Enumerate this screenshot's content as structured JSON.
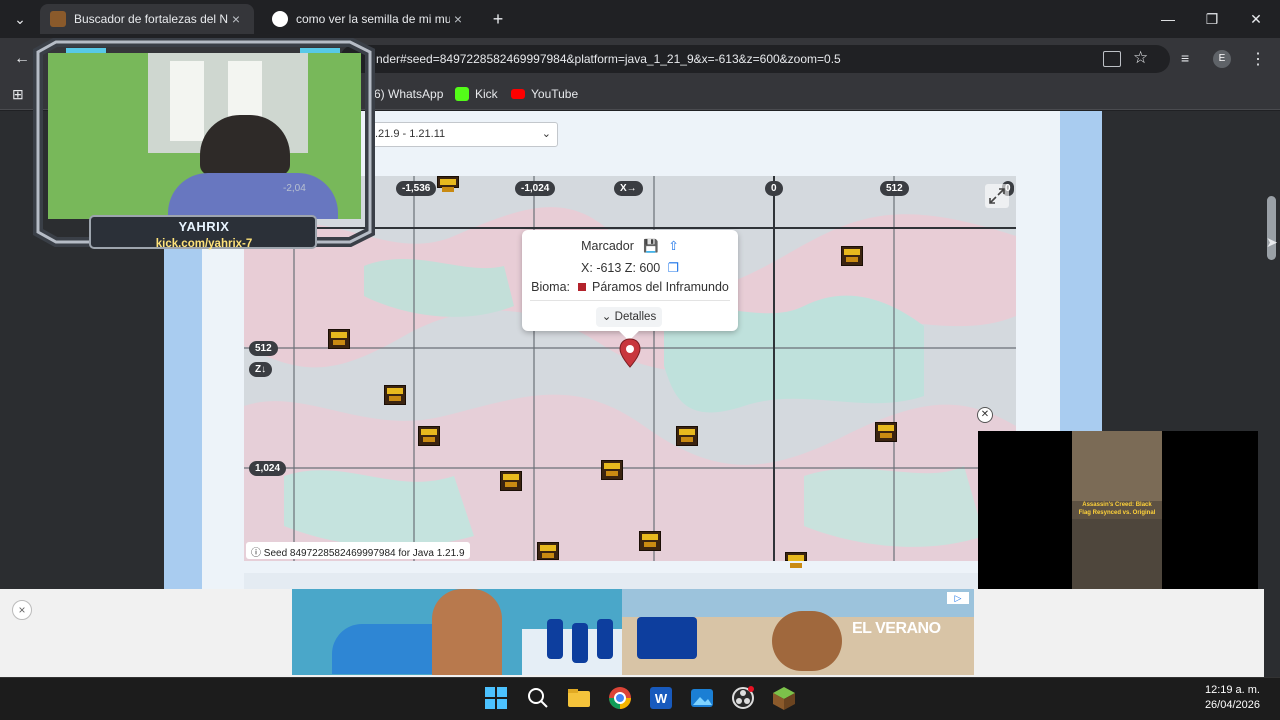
{
  "browser": {
    "tabs": [
      {
        "title": "Buscador de fortalezas del Neth",
        "active": true
      },
      {
        "title": "como ver la semilla de mi mund",
        "active": false
      }
    ],
    "new_tab_icon": "plus-icon",
    "window_controls": [
      "minimize",
      "restore",
      "close"
    ],
    "url": "nder#seed=8497228582469997984&platform=java_1_21_9&x=-613&z=600&zoom=0.5",
    "profile_initial": "E",
    "bookmarks": [
      {
        "label": "6) WhatsApp"
      },
      {
        "label": "Kick"
      },
      {
        "label": "YouTube"
      }
    ]
  },
  "page": {
    "version_select": ".21.9 - 1.21.11",
    "x_axis_labels": [
      "-1,536",
      "-1,024",
      "X→",
      "0",
      "512"
    ],
    "x_axis_label_partial": "0",
    "z_axis_labels": [
      "512",
      "Z↓",
      "1,024"
    ],
    "popup": {
      "title": "Marcador",
      "coords": "X: -613 Z: 600",
      "biome_label": "Bioma:",
      "biome_value": "Páramos del Inframundo",
      "details_button": "Detalles",
      "biome_color": "#b3222b"
    },
    "seed_info": "Seed 8497228582469997984 for Java 1.21.9"
  },
  "overlay": {
    "streamer_name": "YAHRIX",
    "streamer_link": "kick.com/yahrix-7",
    "cam_faint_text": "-2,04"
  },
  "ads": {
    "video_ad_title": "Assassin's Creed: Black Flag Resynced vs. Original",
    "bottom_ad_slogan": "EL VERANO",
    "close_label": "×"
  },
  "taskbar": {
    "time": "12:19 a. m.",
    "date": "26/04/2026"
  },
  "colors": {
    "accent": "#c8363d",
    "map_pink": "#e8cdd6",
    "map_teal": "#bfe1dc",
    "fortress": "#e8b91e"
  }
}
